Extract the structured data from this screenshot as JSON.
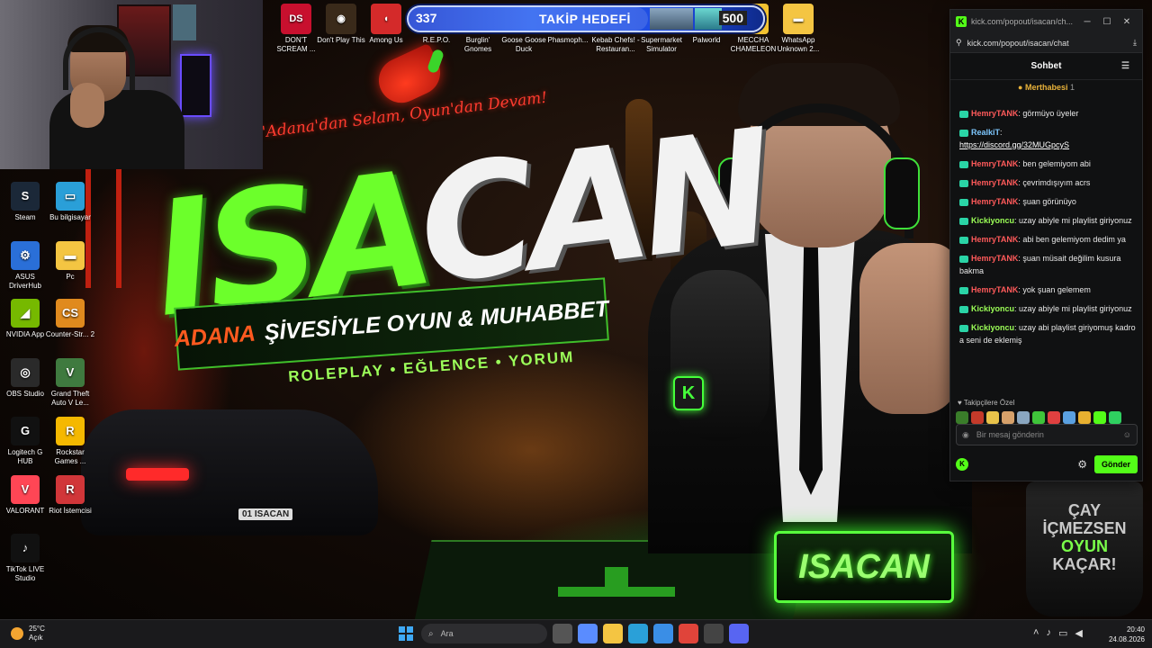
{
  "wallpaper": {
    "tagline": "'Adana'dan Selam, Oyun'dan Devam!",
    "logo_left": "ISA",
    "logo_right": "CAN",
    "banner_accent": "ADANA",
    "banner_text": "ŞİVESİYLE OYUN & MUHABBET",
    "categories": "ROLEPLAY • EĞLENCE • YORUM",
    "nameplate": "ISACAN",
    "plate": "01 ISACAN",
    "mug_line1": "ÇAY",
    "mug_line2": "İÇMEZSEN",
    "mug_line3": "OYUN",
    "mug_line4": "KAÇAR!",
    "mic_letter": "K"
  },
  "top_icons": [
    {
      "label": "DON'T SCREAM ...",
      "icon": "dont-scream-icon",
      "color": "#c8102e",
      "glyph": "DS"
    },
    {
      "label": "Don't Play This",
      "icon": "dont-play-icon",
      "color": "#3a2a1a",
      "glyph": "◉"
    },
    {
      "label": "Among Us",
      "icon": "among-us-icon",
      "color": "#d42a2a",
      "glyph": "◖"
    },
    {
      "label": "R.E.P.O.",
      "icon": "repo-icon",
      "color": "#222",
      "glyph": "R"
    }
  ],
  "top_icons_right": [
    {
      "label": "Burglin' Gnomes",
      "icon": "burglin-gnomes-icon"
    },
    {
      "label": "Goose Goose Duck",
      "icon": "goose-duck-icon"
    },
    {
      "label": "Phasmoph...",
      "icon": "phasmophobia-icon"
    },
    {
      "label": "Kebab Chefs! - Restauran...",
      "icon": "kebab-chefs-icon"
    },
    {
      "label": "Supermarket Simulator",
      "icon": "supermarket-icon"
    },
    {
      "label": "Palworld",
      "icon": "palworld-icon"
    },
    {
      "label": "MECCHA CHAMELEON",
      "icon": "meccha-icon",
      "color": "#f2c230",
      "glyph": "◆"
    },
    {
      "label": "WhatsApp Unknown 2...",
      "icon": "folder-icon",
      "color": "#f4c542",
      "glyph": "▬"
    }
  ],
  "goal": {
    "current": "337",
    "label": "TAKİP HEDEFİ",
    "target": "500",
    "progress": 0.674
  },
  "desktop_icons": [
    {
      "label": "Steam",
      "icon": "steam-icon",
      "color": "#1b2838",
      "glyph": "S"
    },
    {
      "label": "Bu bilgisayar",
      "icon": "this-pc-icon",
      "color": "#2a9fd8",
      "glyph": "▭"
    },
    {
      "label": "ASUS DriverHub",
      "icon": "asus-icon",
      "color": "#2a6fd8",
      "glyph": "⚙"
    },
    {
      "label": "Pc",
      "icon": "folder-icon",
      "color": "#f4c542",
      "glyph": "▬"
    },
    {
      "label": "NVIDIA App",
      "icon": "nvidia-icon",
      "color": "#76b900",
      "glyph": "◢"
    },
    {
      "label": "Counter-Str... 2",
      "icon": "cs2-icon",
      "color": "#e08a1e",
      "glyph": "CS"
    },
    {
      "label": "OBS Studio",
      "icon": "obs-icon",
      "color": "#2a2a2a",
      "glyph": "◎"
    },
    {
      "label": "Grand Theft Auto V Le...",
      "icon": "gta-icon",
      "color": "#3f7a3f",
      "glyph": "V"
    },
    {
      "label": "Logitech G HUB",
      "icon": "logitech-icon",
      "color": "#111",
      "glyph": "G"
    },
    {
      "label": "Rockstar Games ...",
      "icon": "rockstar-icon",
      "color": "#f5b800",
      "glyph": "R"
    },
    {
      "label": "VALORANT",
      "icon": "valorant-icon",
      "color": "#ff4655",
      "glyph": "V"
    },
    {
      "label": "Riot İstemcisi",
      "icon": "riot-icon",
      "color": "#d13639",
      "glyph": "R"
    },
    {
      "label": "TikTok LIVE Studio",
      "icon": "tiktok-icon",
      "color": "#111",
      "glyph": "♪"
    }
  ],
  "chat": {
    "window_title": "kick.com/popout/isacan/ch...",
    "url": "kick.com/popout/isacan/chat",
    "header": "Sohbet",
    "pinned_name": "Merthabesi",
    "pinned_count": "1",
    "messages": [
      {
        "user": "HemryTANK",
        "color": "red",
        "text": "görmüyo üyeler"
      },
      {
        "user": "RealkiT",
        "color": "blue",
        "text": "https://discord.gg/32MUGpcyS",
        "link": true
      },
      {
        "user": "HemryTANK",
        "color": "red",
        "text": "ben gelemiyom abi"
      },
      {
        "user": "HemryTANK",
        "color": "red",
        "text": "çevrimdışıyım acrs"
      },
      {
        "user": "HemryTANK",
        "color": "red",
        "text": "şuan görünüyo"
      },
      {
        "user": "Kickiyoncu",
        "color": "green",
        "text": "uzay abiyle mi playlist giriyonuz"
      },
      {
        "user": "HemryTANK",
        "color": "red",
        "text": "abi ben gelemiyom dedim ya"
      },
      {
        "user": "HemryTANK",
        "color": "red",
        "text": "şuan müsait değilim kusura bakma"
      },
      {
        "user": "HemryTANK",
        "color": "red",
        "text": "yok şuan gelemem"
      },
      {
        "user": "Kickiyoncu",
        "color": "green",
        "text": "uzay abiyle mi playlist giriyonuz"
      },
      {
        "user": "Kickiyoncu",
        "color": "green",
        "text": "uzay abi playlist giriyomuş kadro a seni de eklemiş"
      }
    ],
    "emotes_label": "Takipçilere Özel",
    "emote_colors": [
      "#3a7d2a",
      "#c43a2a",
      "#e8c24a",
      "#d6a06a",
      "#8aa6c0",
      "#3fc43a",
      "#e04040",
      "#5aa0e0",
      "#e8b030",
      "#53fc18",
      "#2fd060"
    ],
    "input_placeholder": "Bir mesaj gönderin",
    "send_label": "Gönder"
  },
  "taskbar": {
    "temp": "25°C",
    "weather": "Açık",
    "search": "Ara",
    "time": "20:40",
    "date": "24.08.2026",
    "apps": [
      {
        "icon": "task-view-icon",
        "color": "#555"
      },
      {
        "icon": "copilot-icon",
        "color": "#5a8cff"
      },
      {
        "icon": "file-explorer-icon",
        "color": "#f4c542"
      },
      {
        "icon": "edge-icon",
        "color": "#2aa0d8"
      },
      {
        "icon": "store-icon",
        "color": "#3a8ee6"
      },
      {
        "icon": "chrome-icon",
        "color": "#e0443a"
      },
      {
        "icon": "obs-icon",
        "color": "#444"
      },
      {
        "icon": "discord-icon",
        "color": "#5865f2"
      }
    ]
  }
}
